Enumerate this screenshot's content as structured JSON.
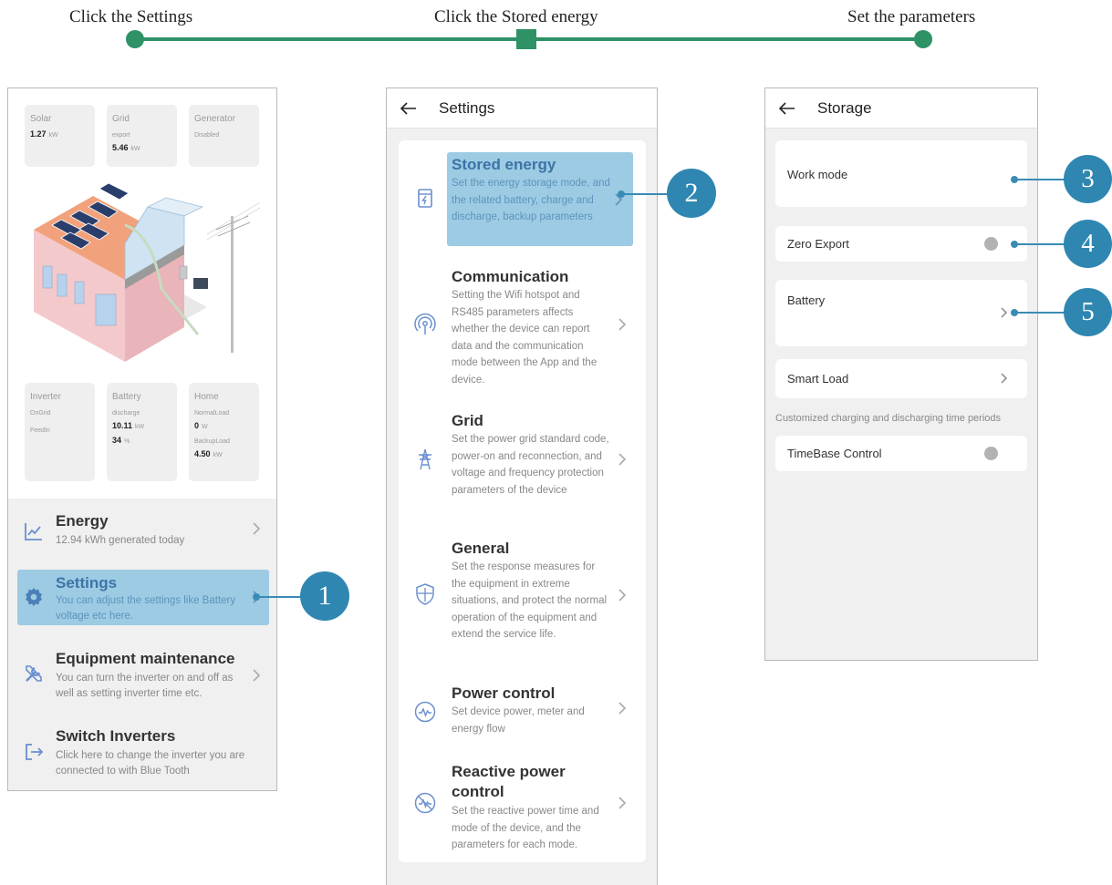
{
  "steps": [
    {
      "label": "Click the Settings"
    },
    {
      "label": "Click the Stored energy"
    },
    {
      "label": "Set the parameters"
    }
  ],
  "home": {
    "cards_top": [
      {
        "title": "Solar",
        "value": "1.27",
        "unit": "kW"
      },
      {
        "title": "Grid",
        "sub": "export",
        "value": "5.46",
        "unit": "kW"
      },
      {
        "title": "Generator",
        "sub": "Disabled"
      }
    ],
    "cards_bottom": [
      {
        "title": "Inverter",
        "sub1": "OnGrid",
        "sub2": "FeedIn"
      },
      {
        "title": "Battery",
        "sub": "discharge",
        "value1": "10.11",
        "unit1": "kW",
        "value2": "34",
        "unit2": "%"
      },
      {
        "title": "Home",
        "sub1": "NormalLoad",
        "value1": "0",
        "unit1": "W",
        "sub2": "BackupLoad",
        "value2": "4.50",
        "unit2": "kW"
      }
    ],
    "menu": [
      {
        "title": "Energy",
        "desc": "12.94 kWh generated today"
      },
      {
        "title": "Settings",
        "desc": "You can adjust the settings like Battery voltage etc here."
      },
      {
        "title": "Equipment maintenance",
        "desc": "You can turn the inverter on and off as well as setting inverter time etc."
      },
      {
        "title": "Switch Inverters",
        "desc": "Click here to change the inverter you are connected to with Blue Tooth"
      }
    ]
  },
  "settings": {
    "title": "Settings",
    "items": [
      {
        "title": "Stored energy",
        "desc": "Set the energy storage mode, and the related battery, charge and discharge, backup parameters"
      },
      {
        "title": "Communication",
        "desc": "Setting the Wifi hotspot and RS485 parameters affects whether the device can report data and the communication mode between the App and the device."
      },
      {
        "title": "Grid",
        "desc": "Set the power grid standard code, power-on and reconnection, and voltage and frequency protection parameters of the device"
      },
      {
        "title": "General",
        "desc": "Set the response measures for the equipment in extreme situations, and protect the normal operation of the equipment and extend the service life."
      },
      {
        "title": "Power control",
        "desc": "Set device power, meter and energy flow"
      },
      {
        "title": "Reactive power control",
        "desc": "Set the reactive power time and mode of the device, and the parameters for each mode."
      }
    ]
  },
  "storage": {
    "title": "Storage",
    "work_mode": "Work mode",
    "zero_export": "Zero Export",
    "battery": "Battery",
    "smart_load": "Smart Load",
    "note": "Customized charging and discharging time periods",
    "timebase": "TimeBase Control"
  },
  "callouts": [
    "1",
    "2",
    "3",
    "4",
    "5"
  ],
  "colors": {
    "step_green": "#2e9266",
    "highlight": "#9ccbe3",
    "callout_blue": "#2f87b1",
    "icon_blue": "#6a8fd0"
  }
}
